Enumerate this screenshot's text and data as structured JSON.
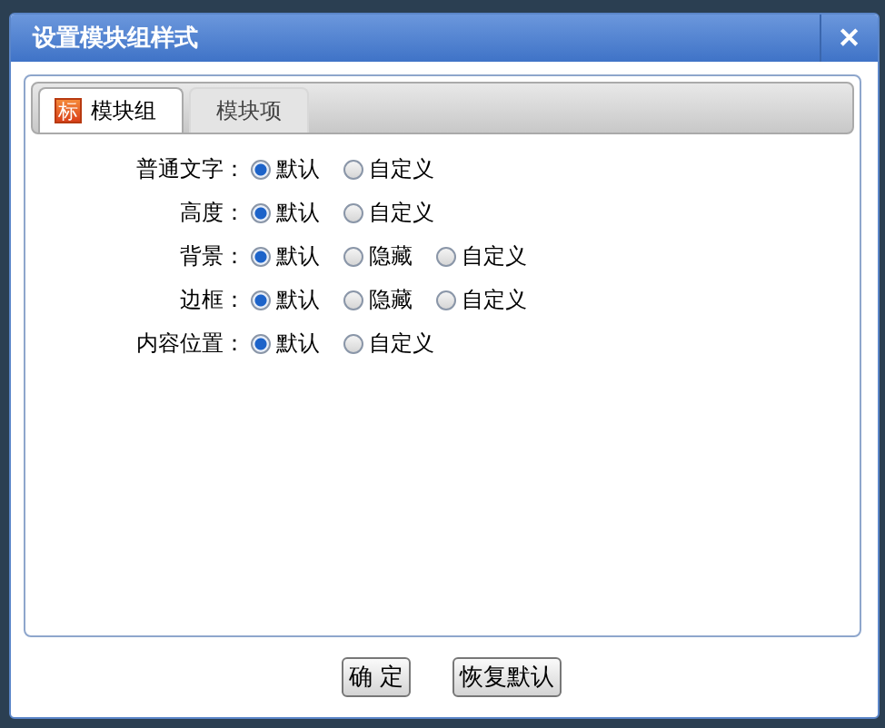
{
  "window": {
    "title": "设置模块组样式",
    "close": "✕"
  },
  "tabs": [
    {
      "label": "模块组",
      "icon": "标",
      "selected": true
    },
    {
      "label": "模块项",
      "selected": false
    }
  ],
  "rows": [
    {
      "label": "普通文字：",
      "options": [
        {
          "label": "默认",
          "selected": true
        },
        {
          "label": "自定义",
          "selected": false
        }
      ]
    },
    {
      "label": "高度：",
      "options": [
        {
          "label": "默认",
          "selected": true
        },
        {
          "label": "自定义",
          "selected": false
        }
      ]
    },
    {
      "label": "背景：",
      "options": [
        {
          "label": "默认",
          "selected": true
        },
        {
          "label": "隐藏",
          "selected": false
        },
        {
          "label": "自定义",
          "selected": false
        }
      ]
    },
    {
      "label": "边框：",
      "options": [
        {
          "label": "默认",
          "selected": true
        },
        {
          "label": "隐藏",
          "selected": false
        },
        {
          "label": "自定义",
          "selected": false
        }
      ]
    },
    {
      "label": "内容位置：",
      "options": [
        {
          "label": "默认",
          "selected": true
        },
        {
          "label": "自定义",
          "selected": false
        }
      ]
    }
  ],
  "buttons": [
    "确 定",
    "恢复默认"
  ]
}
